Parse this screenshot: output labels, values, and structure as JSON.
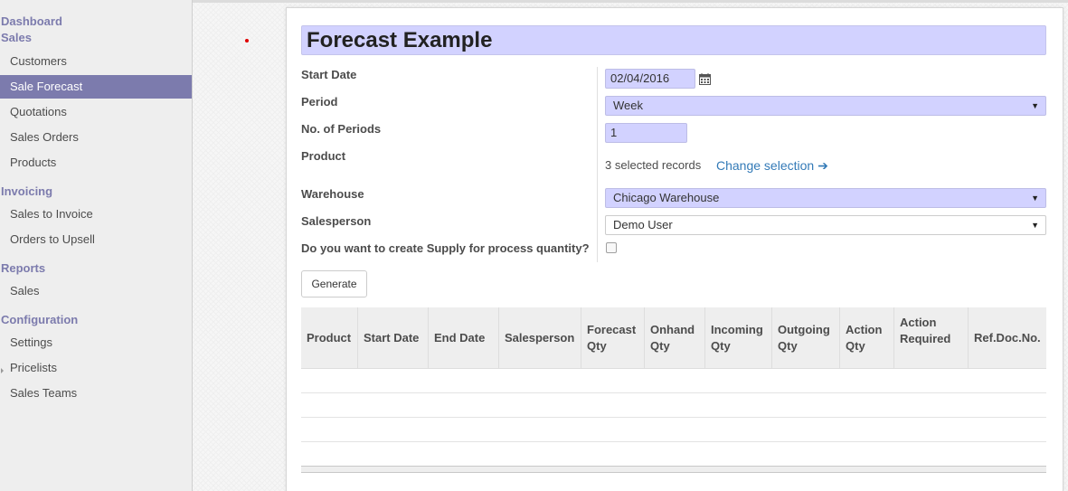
{
  "sidebar": {
    "dashboard": "Dashboard",
    "sales_header": "Sales",
    "sales_items": [
      "Customers",
      "Sale Forecast",
      "Quotations",
      "Sales Orders",
      "Products"
    ],
    "invoicing_header": "Invoicing",
    "invoicing_items": [
      "Sales to Invoice",
      "Orders to Upsell"
    ],
    "reports_header": "Reports",
    "reports_items": [
      "Sales"
    ],
    "configuration_header": "Configuration",
    "configuration_items": [
      "Settings",
      "Pricelists",
      "Sales Teams"
    ]
  },
  "form": {
    "title": "Forecast Example",
    "start_date_label": "Start Date",
    "start_date_value": "02/04/2016",
    "period_label": "Period",
    "period_value": "Week",
    "periods_label": "No. of Periods",
    "periods_value": "1",
    "product_label": "Product",
    "product_records": "3 selected records",
    "change_selection": "Change selection ➔",
    "warehouse_label": "Warehouse",
    "warehouse_value": "Chicago Warehouse",
    "salesperson_label": "Salesperson",
    "salesperson_value": "Demo User",
    "supply_label": "Do you want to create Supply for process quantity?",
    "supply_checked": false,
    "generate_button": "Generate"
  },
  "table": {
    "columns": [
      [
        "Product"
      ],
      [
        "Start Date"
      ],
      [
        "End Date"
      ],
      [
        "Salesperson"
      ],
      [
        "Forecast",
        "Qty"
      ],
      [
        "Onhand",
        "Qty"
      ],
      [
        "Incoming",
        "Qty"
      ],
      [
        "Outgoing",
        "Qty"
      ],
      [
        "Action",
        "Qty"
      ],
      [
        "Action",
        "Required"
      ],
      [
        "Ref.Doc.No."
      ]
    ],
    "rows": []
  },
  "icons": {
    "calendar": "calendar-icon",
    "dropdown": "chevron-down-icon"
  },
  "colors": {
    "accent": "#7c7bad",
    "required_field": "#d2d2ff",
    "link": "#337ab7"
  }
}
